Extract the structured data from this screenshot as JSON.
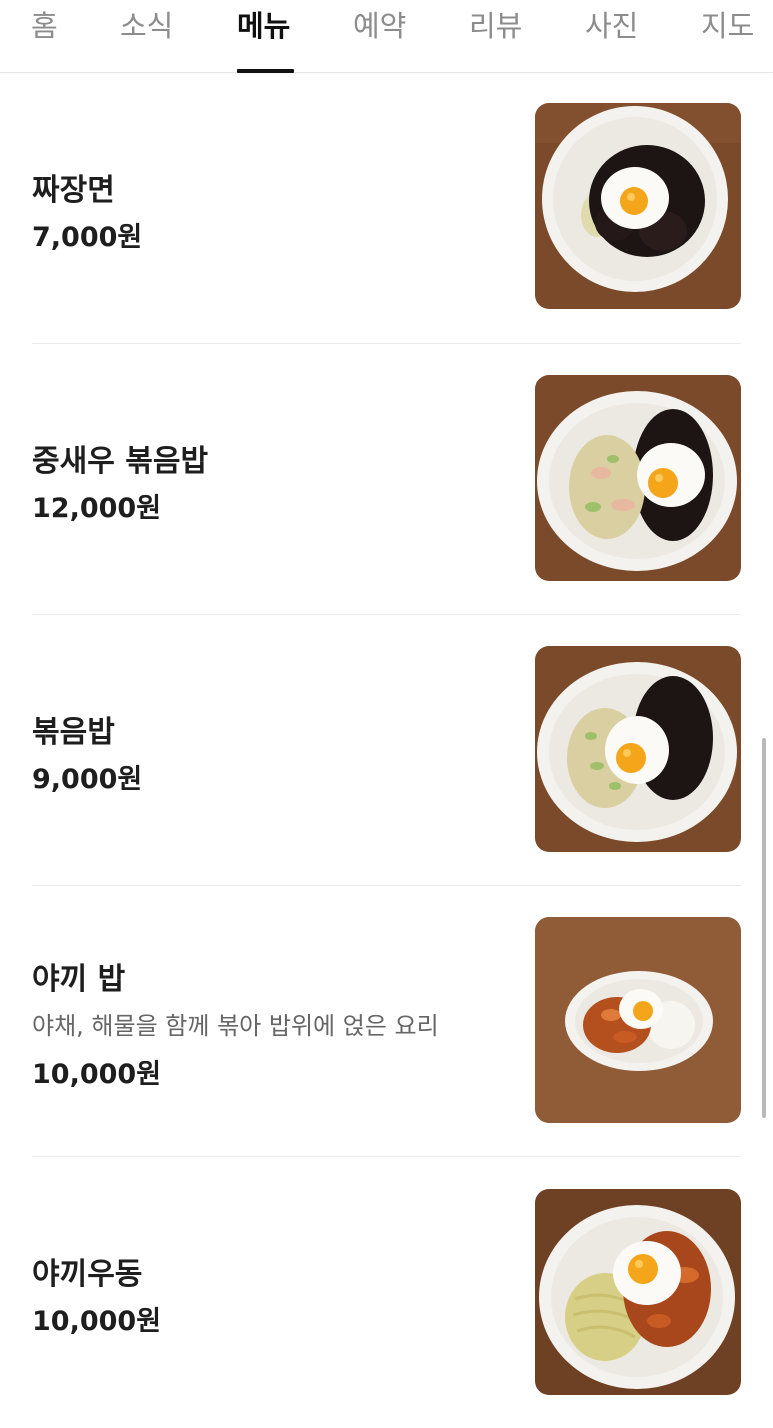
{
  "tabs": [
    {
      "label": "홈",
      "active": false
    },
    {
      "label": "소식",
      "active": false
    },
    {
      "label": "메뉴",
      "active": true
    },
    {
      "label": "예약",
      "active": false
    },
    {
      "label": "리뷰",
      "active": false
    },
    {
      "label": "사진",
      "active": false
    },
    {
      "label": "지도",
      "active": false
    }
  ],
  "menu": [
    {
      "name": "짜장면",
      "description": "",
      "price": "7,000원",
      "photo_icon": "jajangmyeon-photo"
    },
    {
      "name": "중새우 볶음밥",
      "description": "",
      "price": "12,000원",
      "photo_icon": "shrimp-fried-rice-photo"
    },
    {
      "name": "볶음밥",
      "description": "",
      "price": "9,000원",
      "photo_icon": "fried-rice-photo"
    },
    {
      "name": "야끼 밥",
      "description": "야채, 해물을 함께 볶아 밥위에 얹은 요리",
      "price": "10,000원",
      "photo_icon": "yakki-rice-photo"
    },
    {
      "name": "야끼우동",
      "description": "",
      "price": "10,000원",
      "photo_icon": "yakki-udon-photo"
    }
  ],
  "colors": {
    "active_tab": "#111111",
    "inactive_tab": "#8c8c8c",
    "divider": "#ececec",
    "table_wood": "#7a4a2a",
    "plate": "#f4f2ee",
    "black_bean_sauce": "#1d1414",
    "egg_yolk": "#f5a51a",
    "egg_white": "#fbfaf6",
    "fried_rice": "#d9cfa0"
  }
}
